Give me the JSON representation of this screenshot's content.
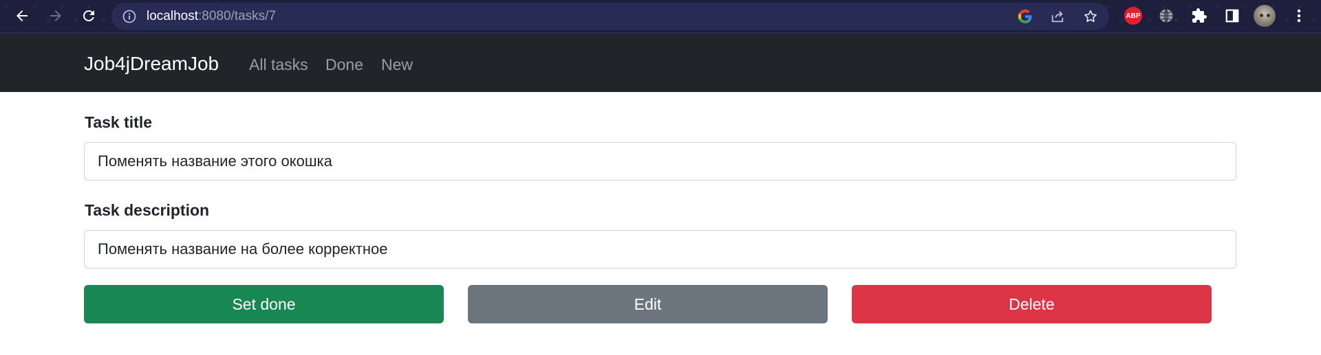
{
  "browser": {
    "url_host": "localhost",
    "url_rest": ":8080/tasks/7",
    "icons": {
      "back": "arrow-left-icon",
      "forward": "arrow-right-icon",
      "reload": "reload-icon",
      "info": "info-icon",
      "google": "google-icon",
      "share": "share-icon",
      "bookmark": "star-icon",
      "adblock": "abp-icon",
      "globe": "globe-icon",
      "extensions": "puzzle-icon",
      "sidepanel": "side-panel-icon",
      "profile": "avatar",
      "menu": "kebab-menu-icon"
    },
    "adblock_label": "ABP"
  },
  "navbar": {
    "brand": "Job4jDreamJob",
    "links": [
      "All tasks",
      "Done",
      "New"
    ]
  },
  "form": {
    "title_label": "Task title",
    "title_value": "Поменять название этого окошка",
    "description_label": "Task description",
    "description_value": "Поменять название на более корректное"
  },
  "actions": {
    "done_label": "Set done",
    "edit_label": "Edit",
    "delete_label": "Delete"
  },
  "colors": {
    "navbar_bg": "#212529",
    "success": "#198754",
    "secondary": "#6c757d",
    "danger": "#dc3545",
    "browser_bg": "#1d1f3c"
  }
}
